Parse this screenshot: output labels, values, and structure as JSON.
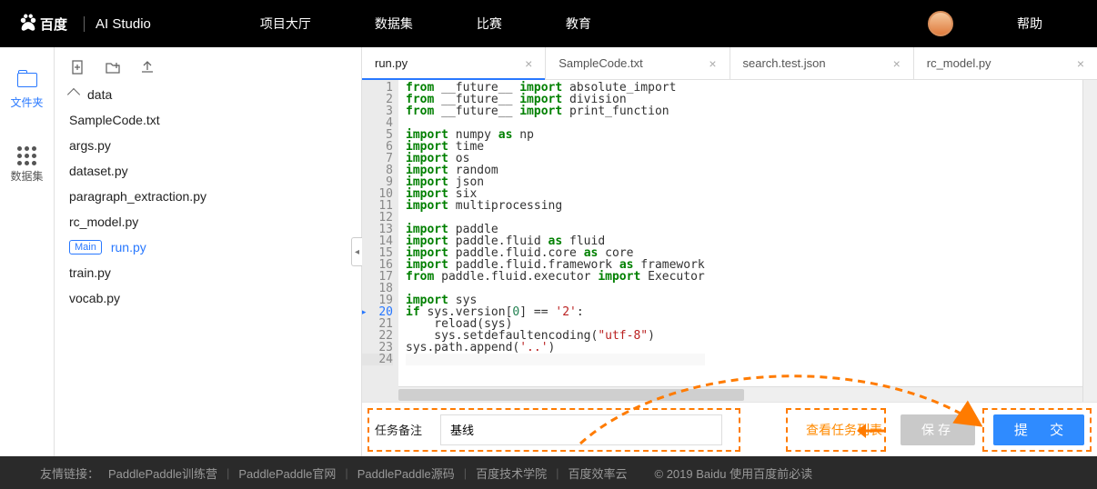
{
  "header": {
    "logo_cn": "百度",
    "logo_ai": "AI Studio",
    "nav": [
      "项目大厅",
      "数据集",
      "比赛",
      "教育"
    ],
    "help": "帮助"
  },
  "rail": {
    "files": "文件夹",
    "dataset": "数据集"
  },
  "explorer": {
    "folder": "data",
    "files": [
      "SampleCode.txt",
      "args.py",
      "dataset.py",
      "paragraph_extraction.py",
      "rc_model.py"
    ],
    "main_badge": "Main",
    "main_file": "run.py",
    "files2": [
      "train.py",
      "vocab.py"
    ]
  },
  "tabs": [
    {
      "label": "run.py",
      "active": true
    },
    {
      "label": "SampleCode.txt",
      "active": false
    },
    {
      "label": "search.test.json",
      "active": false
    },
    {
      "label": "rc_model.py",
      "active": false
    }
  ],
  "code": {
    "lines": [
      {
        "n": 1,
        "html": "<span class='kw'>from</span> __future__ <span class='kw'>import</span> absolute_import"
      },
      {
        "n": 2,
        "html": "<span class='kw'>from</span> __future__ <span class='kw'>import</span> division"
      },
      {
        "n": 3,
        "html": "<span class='kw'>from</span> __future__ <span class='kw'>import</span> print_function"
      },
      {
        "n": 4,
        "html": ""
      },
      {
        "n": 5,
        "html": "<span class='kw'>import</span> numpy <span class='kw'>as</span> np"
      },
      {
        "n": 6,
        "html": "<span class='kw'>import</span> time"
      },
      {
        "n": 7,
        "html": "<span class='kw'>import</span> os"
      },
      {
        "n": 8,
        "html": "<span class='kw'>import</span> random"
      },
      {
        "n": 9,
        "html": "<span class='kw'>import</span> json"
      },
      {
        "n": 10,
        "html": "<span class='kw'>import</span> six"
      },
      {
        "n": 11,
        "html": "<span class='kw'>import</span> multiprocessing"
      },
      {
        "n": 12,
        "html": ""
      },
      {
        "n": 13,
        "html": "<span class='kw'>import</span> paddle"
      },
      {
        "n": 14,
        "html": "<span class='kw'>import</span> paddle.fluid <span class='kw'>as</span> fluid"
      },
      {
        "n": 15,
        "html": "<span class='kw'>import</span> paddle.fluid.core <span class='kw'>as</span> core"
      },
      {
        "n": 16,
        "html": "<span class='kw'>import</span> paddle.fluid.framework <span class='kw'>as</span> framework"
      },
      {
        "n": 17,
        "html": "<span class='kw'>from</span> paddle.fluid.executor <span class='kw'>import</span> Executor"
      },
      {
        "n": 18,
        "html": ""
      },
      {
        "n": 19,
        "html": "<span class='kw'>import</span> sys"
      },
      {
        "n": 20,
        "html": "<span class='kw2'>if</span> sys.version[<span class='num'>0</span>] == <span class='str'>'2'</span>:",
        "mod": true
      },
      {
        "n": 21,
        "html": "    reload(sys)"
      },
      {
        "n": 22,
        "html": "    sys.setdefaultencoding(<span class='str'>\"utf-8\"</span>)"
      },
      {
        "n": 23,
        "html": "sys.path.append(<span class='str'>'..'</span>)"
      },
      {
        "n": 24,
        "html": "",
        "current": true
      }
    ]
  },
  "action": {
    "remark_label": "任务备注",
    "remark_value": "基线",
    "view_tasks": "查看任务列表",
    "save": "保存",
    "submit": "提 交"
  },
  "footer": {
    "label": "友情链接：",
    "links": [
      "PaddlePaddle训练营",
      "PaddlePaddle官网",
      "PaddlePaddle源码",
      "百度技术学院",
      "百度效率云"
    ],
    "copyright": "© 2019 Baidu 使用百度前必读"
  },
  "colors": {
    "accent": "#2878ff",
    "highlight": "#ff7b00"
  }
}
